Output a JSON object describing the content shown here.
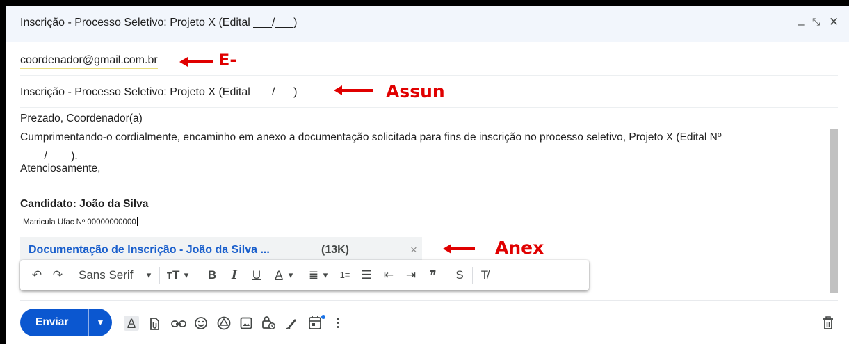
{
  "window": {
    "title": "Inscrição - Processo Seletivo: Projeto X (Edital ___/___)",
    "minimize_glyph": "_",
    "expand_glyph": "⤡",
    "close_glyph": "✕"
  },
  "to": {
    "value": "coordenador@gmail.com.br"
  },
  "subject": {
    "value": "Inscrição - Processo Seletivo: Projeto X  (Edital ___/___)"
  },
  "annotations": {
    "to_label": "E-",
    "subject_label": "Assun",
    "attachment_label": "Anex",
    "color": "#e00000"
  },
  "body": {
    "greeting": "Prezado, Coordenador(a)",
    "line1": "Cumprimentando-o cordialmente, encaminho em anexo a documentação solicitada para fins de inscrição no processo seletivo, Projeto X  (Edital Nº",
    "line2": "____/____).",
    "closing": "Atenciosamente,",
    "candidate": "Candidato: João da Silva",
    "matricula": "Matricula  Ufac Nº  00000000000"
  },
  "attachment": {
    "name": "Documentação de Inscrição - João da Silva ...",
    "size": "(13K)",
    "close_glyph": "×"
  },
  "format_toolbar": {
    "undo": "↶",
    "redo": "↷",
    "font_family": "Sans Serif",
    "dropdown": "▾",
    "font_size": "тT",
    "bold": "B",
    "italic": "I",
    "underline": "U",
    "text_color": "A",
    "align": "≣",
    "numbered_list": "1≡",
    "bulleted_list": "☰",
    "indent_less": "⇤",
    "indent_more": "⇥",
    "quote": "❞",
    "strikethrough": "S",
    "remove_format": "T̸"
  },
  "bottom_toolbar": {
    "send_label": "Enviar",
    "send_more": "▼",
    "formatting": "A",
    "more": "⋮",
    "colors": {
      "send": "#0b57d0",
      "accent_dot": "#1a73e8"
    }
  }
}
